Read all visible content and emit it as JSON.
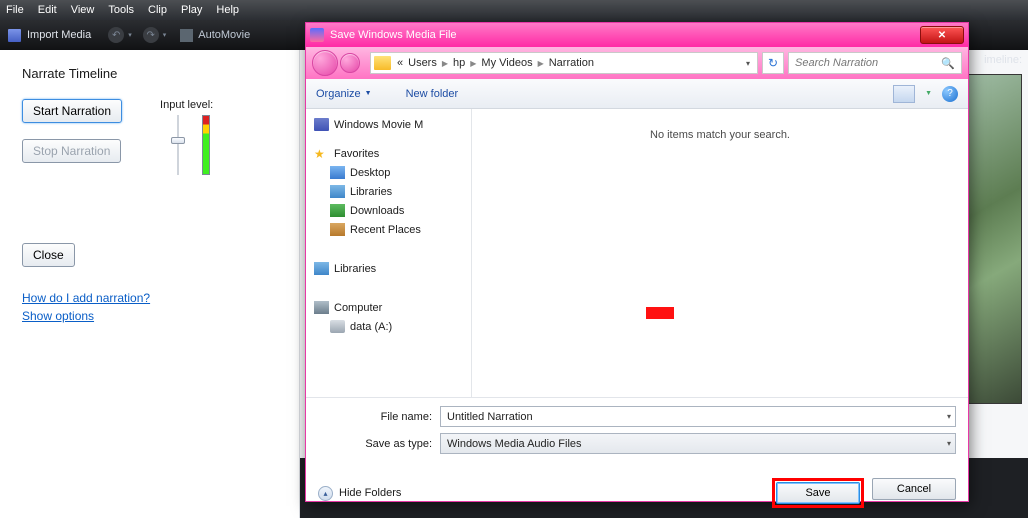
{
  "menu": {
    "items": [
      "File",
      "Edit",
      "View",
      "Tools",
      "Clip",
      "Play",
      "Help"
    ]
  },
  "toolbar": {
    "import": "Import Media",
    "automovie": "AutoMovie"
  },
  "narration": {
    "title": "Narrate Timeline",
    "start": "Start Narration",
    "stop": "Stop Narration",
    "input_level": "Input level:",
    "close": "Close",
    "link1": "How do I add narration?",
    "link2": "Show options"
  },
  "preview_label": "imeline:",
  "dialog": {
    "title": "Save Windows Media File",
    "breadcrumb": {
      "prefix": "«",
      "p1": "Users",
      "p2": "hp",
      "p3": "My Videos",
      "p4": "Narration"
    },
    "search_placeholder": "Search Narration",
    "organize": "Organize",
    "newfolder": "New folder",
    "tree": {
      "wmm": "Windows Movie M",
      "fav": "Favorites",
      "desk": "Desktop",
      "lib": "Libraries",
      "down": "Downloads",
      "recent": "Recent Places",
      "lib2": "Libraries",
      "comp": "Computer",
      "drive": "data (A:)"
    },
    "empty": "No items match your search.",
    "filename_label": "File name:",
    "filename_value": "Untitled Narration",
    "type_label": "Save as type:",
    "type_value": "Windows Media Audio Files",
    "hide": "Hide Folders",
    "save": "Save",
    "cancel": "Cancel"
  }
}
